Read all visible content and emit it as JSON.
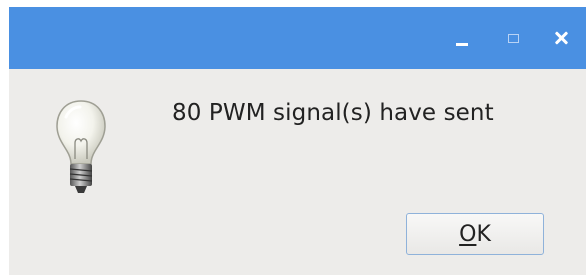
{
  "titlebar": {
    "minimize_icon": "minimize-icon",
    "maximize_icon": "maximize-icon",
    "close_icon": "close-icon",
    "color": "#4a90e2"
  },
  "dialog": {
    "icon": "lightbulb-icon",
    "message": "80 PWM signal(s) have sent",
    "ok_button": {
      "mnemonic": "O",
      "rest": "K"
    },
    "background": "#edecea"
  }
}
